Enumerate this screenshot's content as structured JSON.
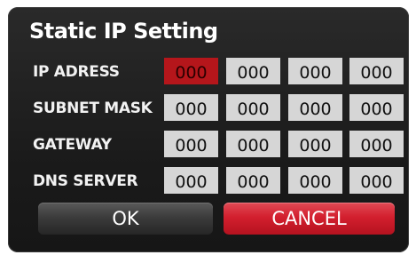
{
  "dialog": {
    "title": "Static IP Setting",
    "rows": [
      {
        "label": "IP ADRESS",
        "octets": [
          "000",
          "000",
          "000",
          "000"
        ]
      },
      {
        "label": "SUBNET MASK",
        "octets": [
          "000",
          "000",
          "000",
          "000"
        ]
      },
      {
        "label": "GATEWAY",
        "octets": [
          "000",
          "000",
          "000",
          "000"
        ]
      },
      {
        "label": "DNS SERVER",
        "octets": [
          "000",
          "000",
          "000",
          "000"
        ]
      }
    ],
    "ok_label": "OK",
    "cancel_label": "CANCEL"
  },
  "colors": {
    "dialog_background": "#1e1e1e",
    "field_background": "#d6d6d6",
    "active_field": "#b5161b",
    "cancel_button": "#d31f2e",
    "ok_button": "#3c3c3c"
  }
}
